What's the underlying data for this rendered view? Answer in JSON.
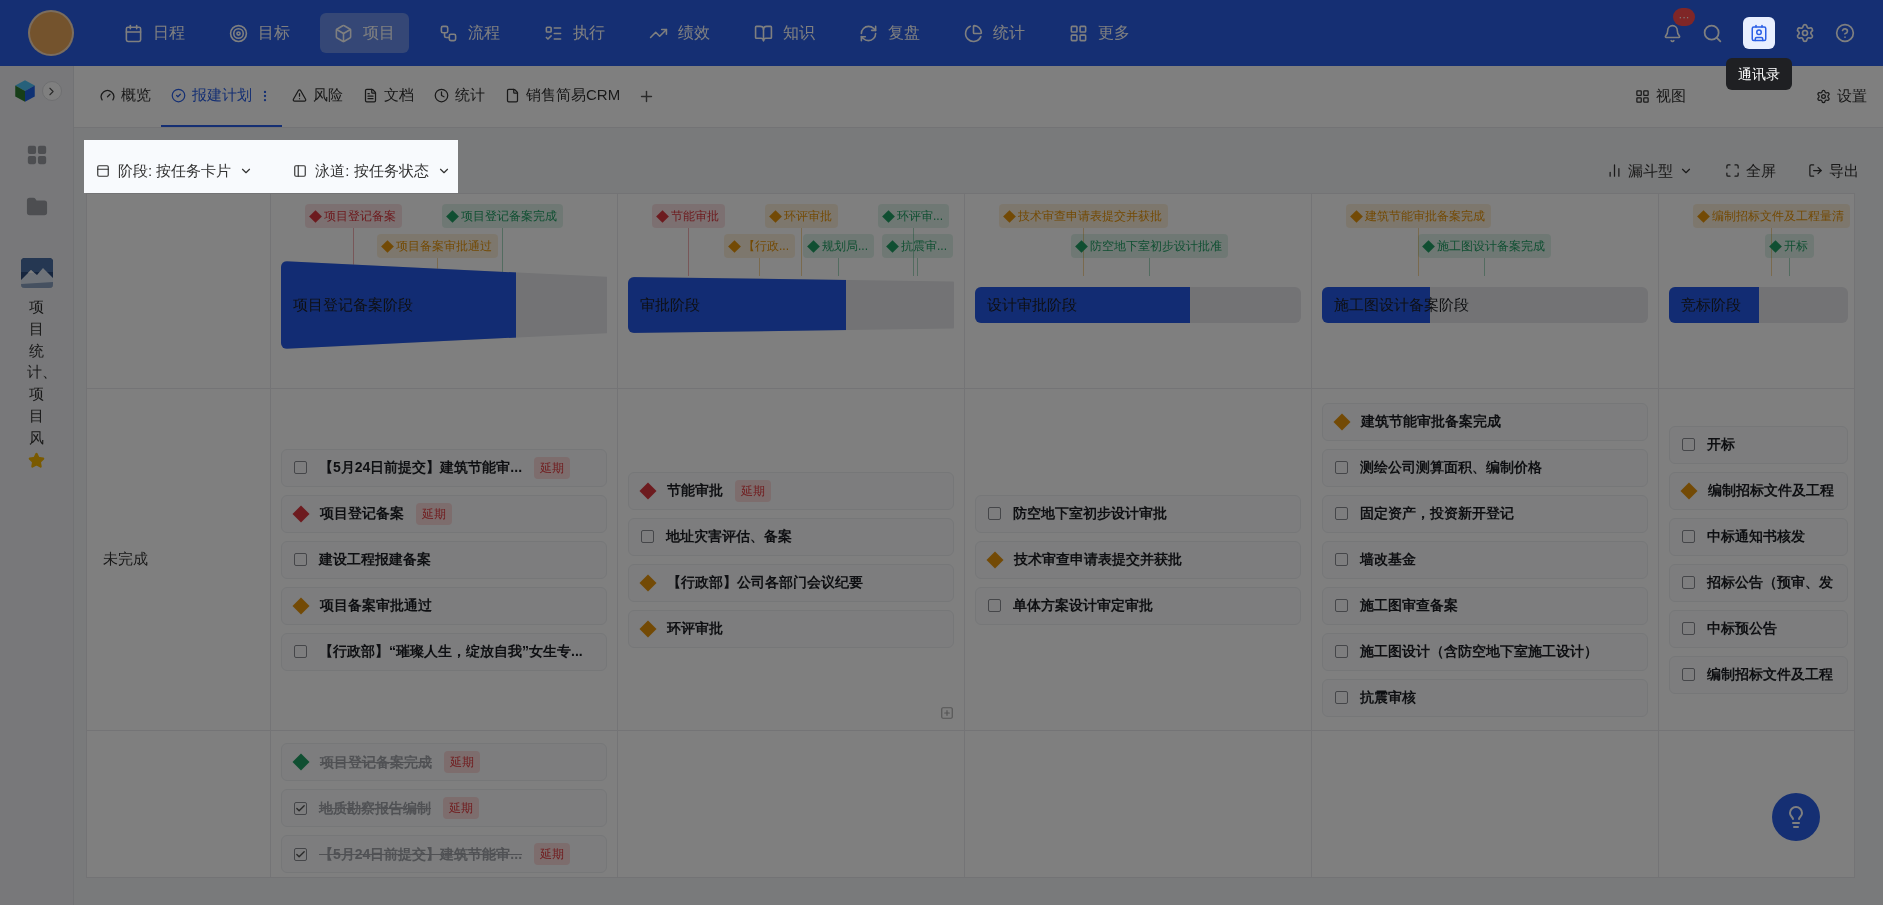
{
  "nav": [
    {
      "label": "日程",
      "selected": false
    },
    {
      "label": "目标",
      "selected": false
    },
    {
      "label": "项目",
      "selected": true
    },
    {
      "label": "流程",
      "selected": false
    },
    {
      "label": "执行",
      "selected": false
    },
    {
      "label": "绩效",
      "selected": false
    },
    {
      "label": "知识",
      "selected": false
    },
    {
      "label": "复盘",
      "selected": false
    },
    {
      "label": "统计",
      "selected": false
    },
    {
      "label": "更多",
      "selected": false
    }
  ],
  "notification_badge": "···",
  "tooltip": "通讯录",
  "tabs": [
    {
      "label": "概览",
      "selected": false
    },
    {
      "label": "报建计划",
      "selected": true
    },
    {
      "label": "风险",
      "selected": false
    },
    {
      "label": "文档",
      "selected": false
    },
    {
      "label": "统计",
      "selected": false
    },
    {
      "label": "销售简易CRM",
      "selected": false
    }
  ],
  "view_actions": [
    "视图",
    "设置"
  ],
  "sidebar": {
    "project_title": "项目统计、项目风",
    "starred": true
  },
  "selectors": [
    {
      "label": "阶段: 按任务卡片"
    },
    {
      "label": "泳道: 按任务状态"
    }
  ],
  "toolbar": {
    "chart_type": "漏斗型",
    "fullscreen": "全屏",
    "export": "导出"
  },
  "stages": [
    {
      "name": "项目登记备案阶段",
      "level": 0.72,
      "row1": [
        {
          "text": "项目登记备案",
          "color": "#6d1b1f"
        },
        {
          "text": "项目登记备案完成",
          "color": "#104f32"
        }
      ],
      "row2": [
        {
          "text": "项目备案审批通过",
          "color": "#734a05"
        }
      ]
    },
    {
      "name": "审批阶段",
      "level": 0.67,
      "row1": [
        {
          "text": "节能审批",
          "color": "#6d1b1f"
        },
        {
          "text": "环评审批",
          "color": "#734a05"
        },
        {
          "text": "环评审...",
          "color": "#104f32"
        }
      ],
      "row2": [
        {
          "text": "【行政...",
          "color": "#734a05"
        },
        {
          "text": "规划局...",
          "color": "#104f32"
        },
        {
          "text": "抗震审...",
          "color": "#104f32"
        }
      ]
    },
    {
      "name": "设计审批阶段",
      "level": 0.66,
      "row1": [
        {
          "text": "技术审查申请表提交并获批",
          "color": "#734a05"
        }
      ],
      "row2": [
        {
          "text": "防空地下室初步设计批准",
          "color": "#104f32"
        }
      ]
    },
    {
      "name": "施工图设计备案阶段",
      "level": 0.33,
      "row1": [
        {
          "text": "建筑节能审批备案完成",
          "color": "#734a05"
        }
      ],
      "row2": [
        {
          "text": "施工图设计备案完成",
          "color": "#104f32"
        }
      ]
    },
    {
      "name": "竞标阶段",
      "level": 0.5,
      "row1": [
        {
          "text": "编制招标文件及工程量清",
          "color": "#734a05"
        }
      ],
      "row2": [
        {
          "text": "开标",
          "color": "#104f32"
        }
      ]
    }
  ],
  "lanes": [
    {
      "label": "未完成",
      "columns": [
        [
          {
            "kind": "task",
            "checked": false,
            "done": false,
            "text": "【5月24日前提交】建筑节能审...",
            "badge": "延期"
          },
          {
            "kind": "milestone",
            "color": "#6d1b1f",
            "done": false,
            "text": "项目登记备案",
            "badge": "延期"
          },
          {
            "kind": "task",
            "checked": false,
            "done": false,
            "text": "建设工程报建备案"
          },
          {
            "kind": "milestone",
            "color": "#734a05",
            "done": false,
            "text": "项目备案审批通过"
          },
          {
            "kind": "task",
            "checked": false,
            "done": false,
            "text": "【行政部】“璀璨人生，绽放自我”女生专..."
          }
        ],
        [
          {
            "kind": "milestone",
            "color": "#6d1b1f",
            "done": false,
            "text": "节能审批",
            "badge": "延期"
          },
          {
            "kind": "task",
            "checked": false,
            "done": false,
            "text": "地址灾害评估、备案"
          },
          {
            "kind": "milestone",
            "color": "#734a05",
            "done": false,
            "text": "【行政部】公司各部门会议纪要"
          },
          {
            "kind": "milestone",
            "color": "#734a05",
            "done": false,
            "text": "环评审批"
          }
        ],
        [
          {
            "kind": "task",
            "checked": false,
            "done": false,
            "text": "防空地下室初步设计审批"
          },
          {
            "kind": "milestone",
            "color": "#734a05",
            "done": false,
            "text": "技术审查申请表提交并获批"
          },
          {
            "kind": "task",
            "checked": false,
            "done": false,
            "text": "单体方案设计审定审批"
          }
        ],
        [
          {
            "kind": "milestone",
            "color": "#734a05",
            "done": false,
            "text": "建筑节能审批备案完成"
          },
          {
            "kind": "task",
            "checked": false,
            "done": false,
            "text": "测绘公司测算面积、编制价格"
          },
          {
            "kind": "task",
            "checked": false,
            "done": false,
            "text": "固定资产，投资新开登记"
          },
          {
            "kind": "task",
            "checked": false,
            "done": false,
            "text": "墙改基金"
          },
          {
            "kind": "task",
            "checked": false,
            "done": false,
            "text": "施工图审查备案"
          },
          {
            "kind": "task",
            "checked": false,
            "done": false,
            "text": "施工图设计（含防空地下室施工设计）"
          },
          {
            "kind": "task",
            "checked": false,
            "done": false,
            "text": "抗震审核"
          }
        ],
        [
          {
            "kind": "task",
            "checked": false,
            "done": false,
            "text": "开标"
          },
          {
            "kind": "milestone",
            "color": "#734a05",
            "done": false,
            "text": "编制招标文件及工程"
          },
          {
            "kind": "task",
            "checked": false,
            "done": false,
            "text": "中标通知书核发"
          },
          {
            "kind": "task",
            "checked": false,
            "done": false,
            "text": "招标公告（预审、发"
          },
          {
            "kind": "task",
            "checked": false,
            "done": false,
            "text": "中标预公告"
          },
          {
            "kind": "task",
            "checked": false,
            "done": false,
            "text": "编制招标文件及工程"
          }
        ]
      ]
    },
    {
      "columns": [
        [
          {
            "kind": "milestone",
            "color": "#104f32",
            "done": true,
            "text": "项目登记备案完成",
            "badge": "延期"
          },
          {
            "kind": "task",
            "checked": true,
            "done": true,
            "text": "地质勘察报告编制",
            "badge": "延期"
          },
          {
            "kind": "task",
            "checked": true,
            "done": true,
            "text": "【5月24日前提交】建筑节能审...",
            "badge": "延期"
          }
        ],
        [],
        [],
        [],
        []
      ]
    }
  ]
}
